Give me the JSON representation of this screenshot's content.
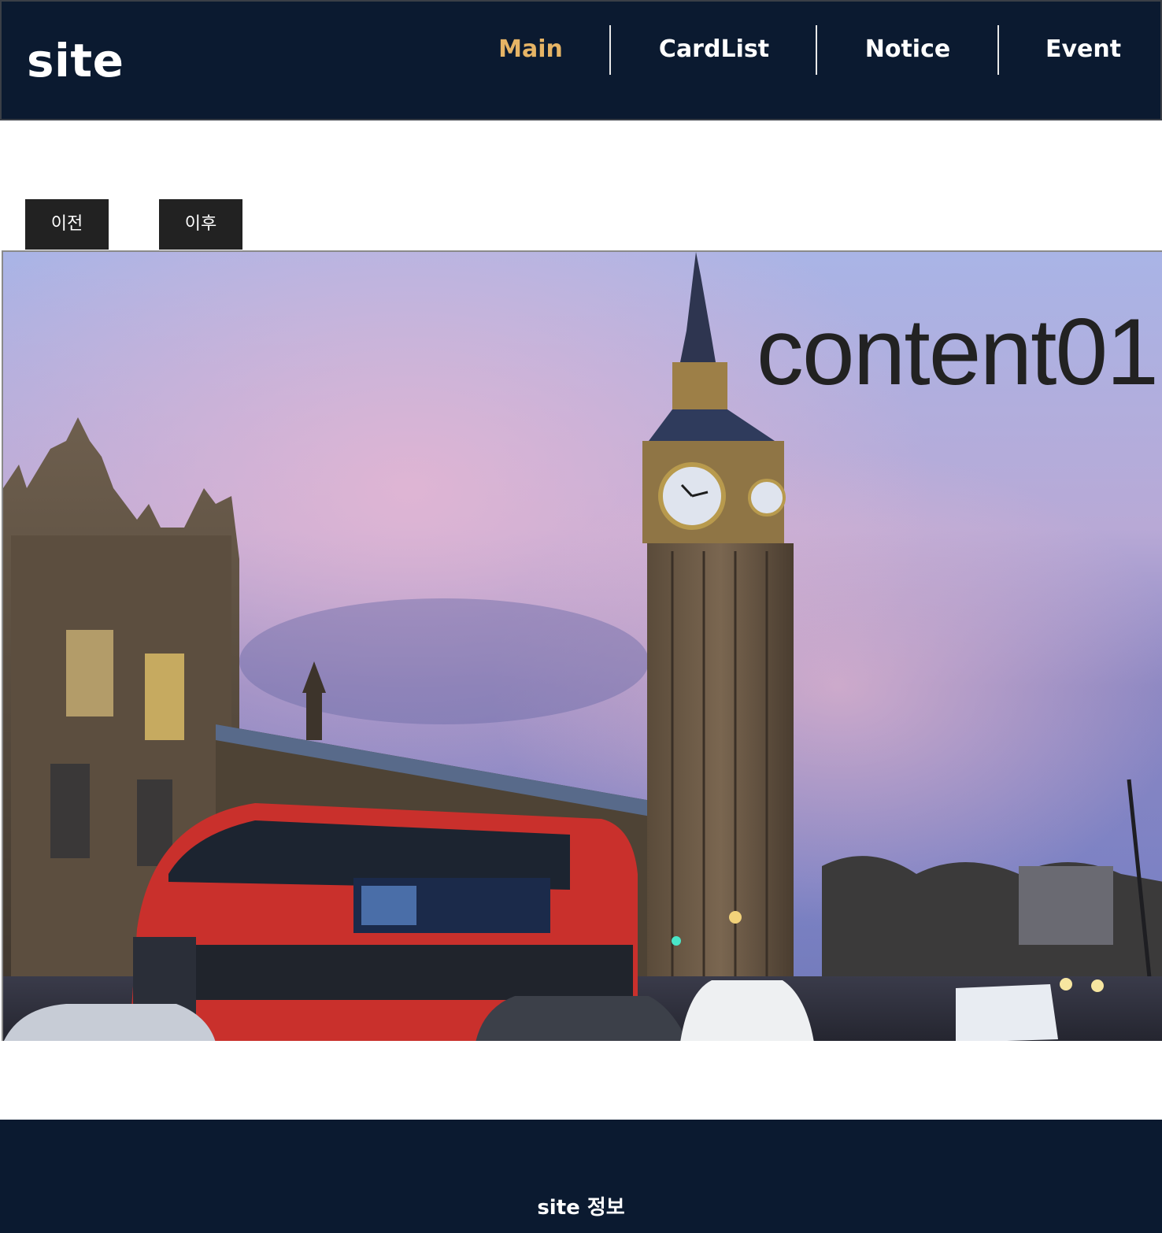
{
  "header": {
    "logo": "site",
    "nav": [
      {
        "label": "Main",
        "active": true
      },
      {
        "label": "CardList",
        "active": false
      },
      {
        "label": "Notice",
        "active": false
      },
      {
        "label": "Event",
        "active": false
      }
    ],
    "nav_active_color": "#e6b465",
    "background_color": "#0b1a30"
  },
  "slider": {
    "prev_label": "이전",
    "next_label": "이후",
    "button_color": "#222222",
    "slide": {
      "title": "content01",
      "image": "photo"
    }
  },
  "footer": {
    "text": "site 정보"
  }
}
